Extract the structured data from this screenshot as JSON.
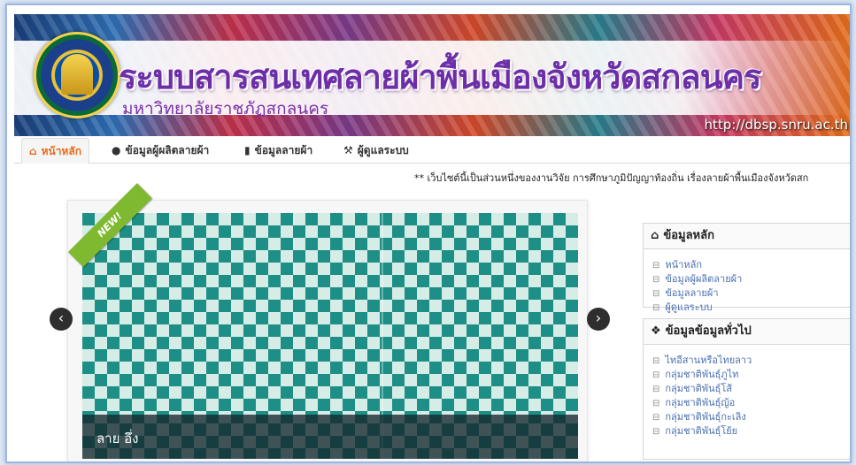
{
  "banner": {
    "title": "ระบบสารสนเทศลายผ้าพื้นเมืองจังหวัดสกลนคร",
    "subtitle": "มหาวิทยาลัยราชภัฏสกลนคร",
    "url": "http://dbsp.snru.ac.th"
  },
  "nav": {
    "items": [
      {
        "label": "หน้าหลัก",
        "icon": "home-icon"
      },
      {
        "label": "ข้อมูลผู้ผลิตลายผ้า",
        "icon": "user-icon"
      },
      {
        "label": "ข้อมูลลายผ้า",
        "icon": "book-icon"
      },
      {
        "label": "ผู้ดูแลระบบ",
        "icon": "wrench-icon"
      }
    ]
  },
  "marquee": "** เว็บไซต์นี้เป็นส่วนหนึ่งของงานวิจัย การศึกษาภูมิปัญญาท้องถิ่น เรื่องลายผ้าพื้นเมืองจังหวัดสก",
  "slider": {
    "ribbon": "NEW!",
    "caption": "ลาย อึ่ง"
  },
  "sidebar": {
    "main": {
      "title": "ข้อมูลหลัก",
      "items": [
        "หน้าหลัก",
        "ข้อมูลผู้ผลิตลายผ้า",
        "ข้อมูลลายผ้า",
        "ผู้ดูแลระบบ"
      ]
    },
    "general": {
      "title": "ข้อมูลข้อมูลทั่วไป",
      "items": [
        "ไทอีสานหรือไทยลาว",
        "กลุ่มชาติพันธุ์ภูไท",
        "กลุ่มชาติพันธุ์โส้",
        "กลุ่มชาติพันธุ์ญ้อ",
        "กลุ่มชาติพันธุ์กะเลิง",
        "กลุ่มชาติพันธุ์โย้ย"
      ]
    }
  }
}
